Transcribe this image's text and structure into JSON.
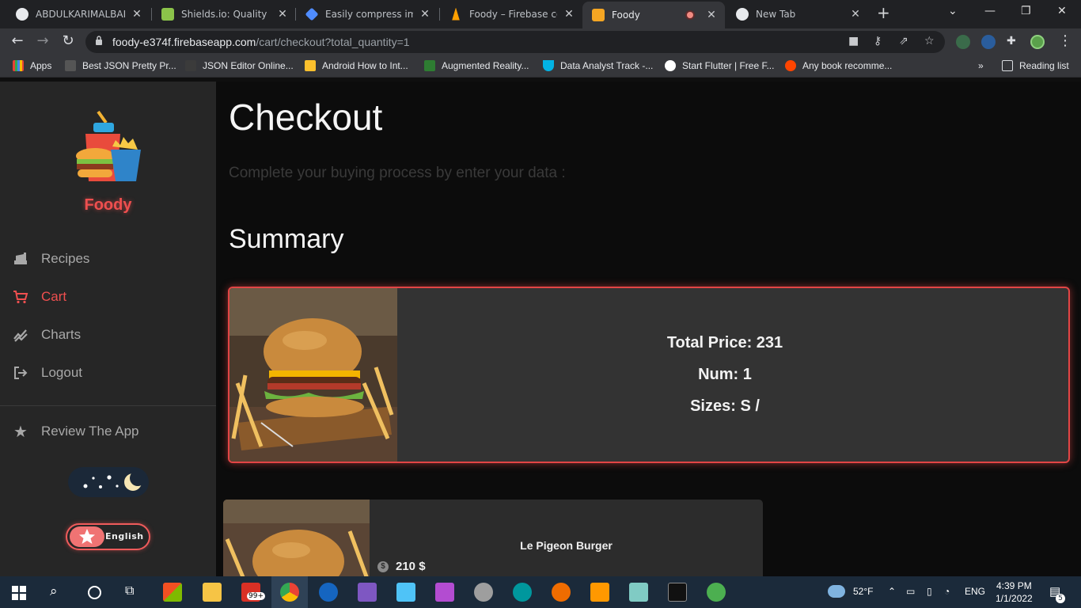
{
  "browser": {
    "tabs": [
      {
        "title": "ABDULKARIMALBAIK/",
        "color": "#e8eaed"
      },
      {
        "title": "Shields.io: Quality met",
        "color": "#8bc34a"
      },
      {
        "title": "Easily compress image",
        "color": "#4f8cff"
      },
      {
        "title": "Foody – Firebase cons",
        "color": "#ffa000"
      },
      {
        "title": "Foody",
        "color": "#f5a623"
      },
      {
        "title": "New Tab",
        "color": "#e8eaed"
      }
    ],
    "url_host": "foody-e374f.firebaseapp.com",
    "url_path": "/cart/checkout?total_quantity=1",
    "bookmarks": [
      {
        "label": "Apps",
        "color": "#e94235"
      },
      {
        "label": "Best JSON Pretty Pr...",
        "color": "#555555"
      },
      {
        "label": "JSON Editor Online...",
        "color": "#3b3b3b"
      },
      {
        "label": "Android How to Int...",
        "color": "#fbc02d"
      },
      {
        "label": "Augmented Reality...",
        "color": "#2e7d32"
      },
      {
        "label": "Data Analyst Track -...",
        "color": "#02b3e4"
      },
      {
        "label": "Start Flutter | Free F...",
        "color": "#ffffff"
      },
      {
        "label": "Any book recomme...",
        "color": "#ff4500"
      }
    ],
    "overflow": "»",
    "reading_list": "Reading list"
  },
  "app": {
    "brand": "Foody",
    "nav": [
      {
        "label": "Recipes",
        "icon": "recipes-icon",
        "active": false
      },
      {
        "label": "Cart",
        "icon": "cart-icon",
        "active": true
      },
      {
        "label": "Charts",
        "icon": "charts-icon",
        "active": false
      },
      {
        "label": "Logout",
        "icon": "logout-icon",
        "active": false
      }
    ],
    "review": "Review The App",
    "language": "English",
    "accent": "#ef4f4f"
  },
  "checkout": {
    "title": "Checkout",
    "subtitle": "Complete your buying process by enter your data :",
    "summary_title": "Summary",
    "total_price": "Total Price: 231",
    "num": "Num: 1",
    "sizes": "Sizes: S /"
  },
  "item": {
    "name": "Le Pigeon Burger",
    "price": "210 $"
  },
  "taskbar": {
    "badge": "99+",
    "weather": "52°F",
    "lang": "ENG",
    "time": "4:39 PM",
    "date": "1/1/2022",
    "notifications": "5"
  }
}
